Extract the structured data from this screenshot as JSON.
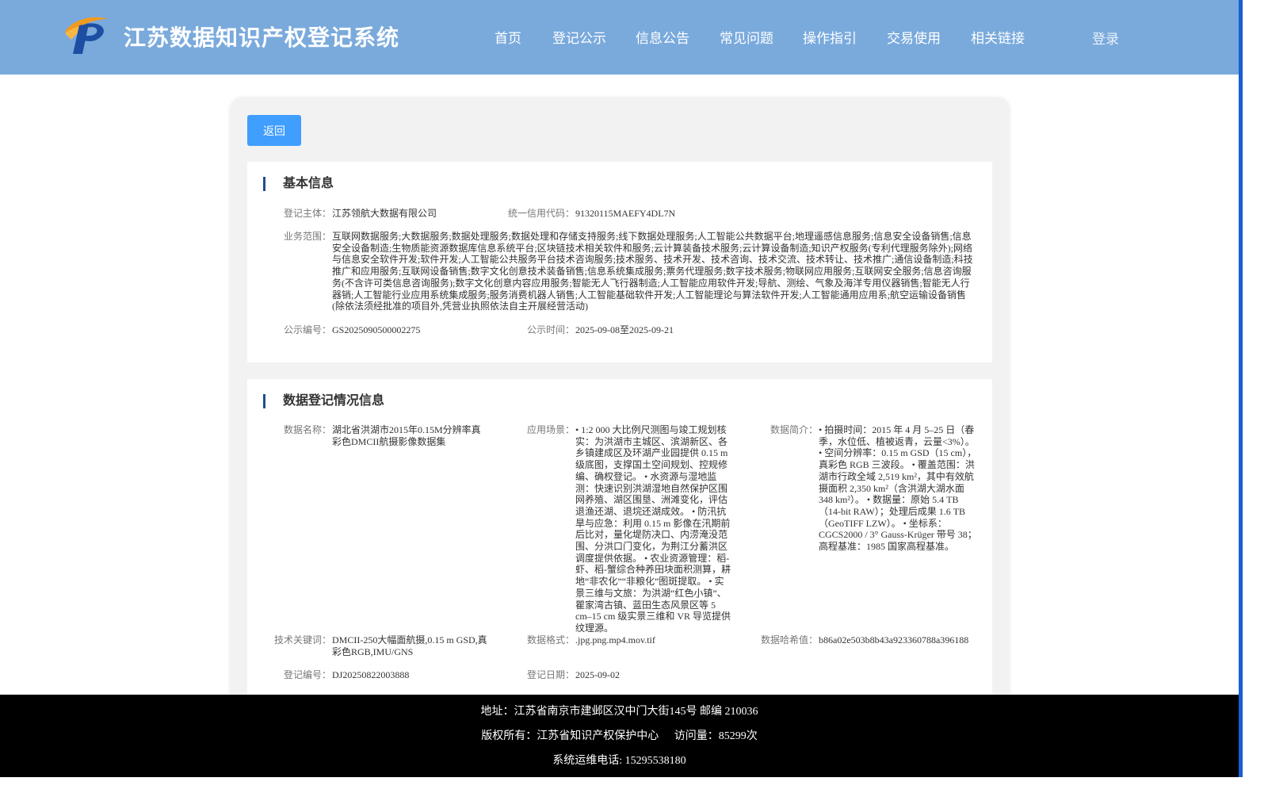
{
  "header": {
    "title": "江苏数据知识产权登记系统",
    "nav": [
      "首页",
      "登记公示",
      "信息公告",
      "常见问题",
      "操作指引",
      "交易使用",
      "相关链接"
    ],
    "login": "登录"
  },
  "actions": {
    "back": "返回"
  },
  "basic": {
    "title": "基本信息",
    "subject_label": "登记主体：",
    "subject": "江苏领航大数据有限公司",
    "credit_label": "统一信用代码：",
    "credit": "91320115MAEFY4DL7N",
    "scope_label": "业务范围：",
    "scope": "互联网数据服务;大数据服务;数据处理服务;数据处理和存储支持服务;线下数据处理服务;人工智能公共数据平台;地理遥感信息服务;信息安全设备销售;信息安全设备制造;生物质能资源数据库信息系统平台;区块链技术相关软件和服务;云计算装备技术服务;云计算设备制造;知识产权服务(专利代理服务除外);网络与信息安全软件开发;软件开发;人工智能公共服务平台技术咨询服务;技术服务、技术开发、技术咨询、技术交流、技术转让、技术推广;通信设备制造;科技推广和应用服务;互联网设备销售;数字文化创意技术装备销售;信息系统集成服务;票务代理服务;数字技术服务;物联网应用服务;互联网安全服务;信息咨询服务(不含许可类信息咨询服务);数字文化创意内容应用服务;智能无人飞行器制造;人工智能应用软件开发;导航、测绘、气象及海洋专用仪器销售;智能无人行器销;人工智能行业应用系统集成服务;服务消费机器人销售;人工智能基础软件开发;人工智能理论与算法软件开发;人工智能通用应用系;航空运输设备销售(除依法须经批准的项目外,凭营业执照依法自主开展经营活动)",
    "notice_no_label": "公示编号：",
    "notice_no": "GS2025090500002275",
    "notice_time_label": "公示时间：",
    "notice_time": "2025-09-08至2025-09-21"
  },
  "registration": {
    "title": "数据登记情况信息",
    "name_label": "数据名称：",
    "name": "湖北省洪湖市2015年0.15M分辨率真彩色DMCII航摄影像数据集",
    "scenario_label": "应用场景：",
    "scenario": "• 1:2 000 大比例尺测图与竣工规划核实：为洪湖市主城区、滨湖新区、各乡镇建成区及环湖产业园提供 0.15 m 级底图，支撑国土空间规划、控规修编、确权登记。 • 水资源与湿地监测：快速识别洪湖湿地自然保护区围网养殖、湖区围垦、洲滩变化，评估退渔还湖、退垸还湖成效。 • 防汛抗旱与应急：利用 0.15 m 影像在汛期前后比对，量化堤防决口、内涝淹没范围、分洪口门变化，为荆江分蓄洪区调度提供依据。 • 农业资源管理：稻-虾、稻-蟹综合种养田块面积测算，耕地“非农化”“非粮化”图斑提取。 • 实景三维与文旅：为洪湖“红色小镇”、瞿家湾古镇、蓝田生态风景区等 5 cm–15 cm 级实景三维和 VR 导览提供纹理源。",
    "intro_label": "数据简介：",
    "intro": "• 拍摄时间：2015 年 4 月 5–25 日（春季，水位低、植被返青，云量<3%）。 • 空间分辨率：0.15 m GSD（15 cm），真彩色 RGB 三波段。 • 覆盖范围：洪湖市行政全域 2,519 km²，其中有效航摄面积 2,350 km²（含洪湖大湖水面 348 km²）。 • 数据量：原始 5.4 TB（14-bit RAW）；处理后成果 1.6 TB（GeoTIFF LZW）。 • 坐标系：CGCS2000 / 3° Gauss-Krüger 带号 38；高程基准：1985 国家高程基准。",
    "keywords_label": "技术关键词：",
    "keywords": "DMCII-250大幅面航摄,0.15 m GSD,真彩色RGB,IMU/GNS",
    "format_label": "数据格式：",
    "format": ".jpg.png.mp4.mov.tif",
    "hash_label": "数据哈希值：",
    "hash": "b86a02e503b8b43a923360788a396188",
    "reg_no_label": "登记编号：",
    "reg_no": "DJ20250822003888",
    "reg_date_label": "登记日期：",
    "reg_date": "2025-09-02"
  },
  "footer": {
    "address": "地址：江苏省南京市建邺区汉中门大街145号 邮编 210036",
    "copyright": "版权所有：江苏省知识产权保护中心",
    "visits": "访问量：85299次",
    "phone": "系统运维电话: 15295538180"
  },
  "colors": {
    "header_bg": "#7aaadc",
    "button": "#409eff",
    "section_bar": "#1f4e8c",
    "footer_bg": "#000000"
  }
}
